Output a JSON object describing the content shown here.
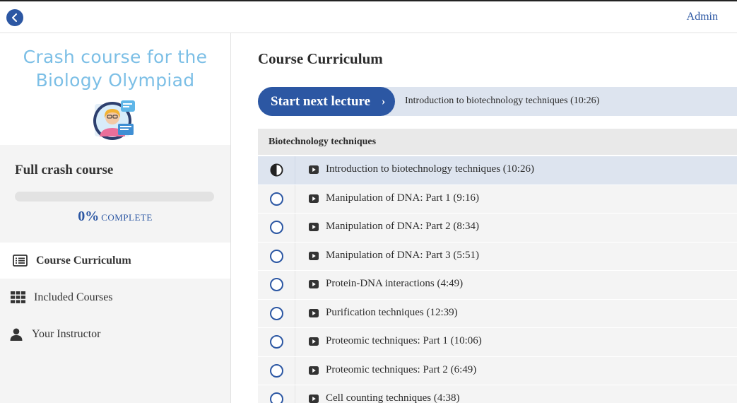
{
  "header": {
    "admin_label": "Admin"
  },
  "sidebar": {
    "course_title_line1": "Crash course for the",
    "course_title_line2": "Biology Olympiad",
    "section_title": "Full crash course",
    "progress_percent": 0,
    "progress_pct_text": "0%",
    "progress_complete_label": "COMPLETE",
    "nav": [
      {
        "label": "Course Curriculum",
        "icon": "list-icon",
        "active": true
      },
      {
        "label": "Included Courses",
        "icon": "grid-icon",
        "active": false
      },
      {
        "label": "Your Instructor",
        "icon": "user-icon",
        "active": false
      }
    ]
  },
  "main": {
    "title": "Course Curriculum",
    "next_button_label": "Start next lecture",
    "next_lecture": "Introduction to biotechnology techniques (10:26)",
    "section": "Biotechnology techniques",
    "lectures": [
      {
        "title": "Introduction to biotechnology techniques (10:26)",
        "status": "in-progress"
      },
      {
        "title": "Manipulation of DNA: Part 1 (9:16)",
        "status": "not-started"
      },
      {
        "title": "Manipulation of DNA: Part 2 (8:34)",
        "status": "not-started"
      },
      {
        "title": "Manipulation of DNA: Part 3 (5:51)",
        "status": "not-started"
      },
      {
        "title": "Protein-DNA interactions (4:49)",
        "status": "not-started"
      },
      {
        "title": "Purification techniques (12:39)",
        "status": "not-started"
      },
      {
        "title": "Proteomic techniques: Part 1 (10:06)",
        "status": "not-started"
      },
      {
        "title": "Proteomic techniques: Part 2 (6:49)",
        "status": "not-started"
      },
      {
        "title": "Cell counting techniques (4:38)",
        "status": "not-started"
      }
    ]
  },
  "colors": {
    "accent": "#2c57a3",
    "title_blue": "#7cbfe6",
    "current_row": "#dde4ef",
    "row": "#f4f4f4"
  }
}
